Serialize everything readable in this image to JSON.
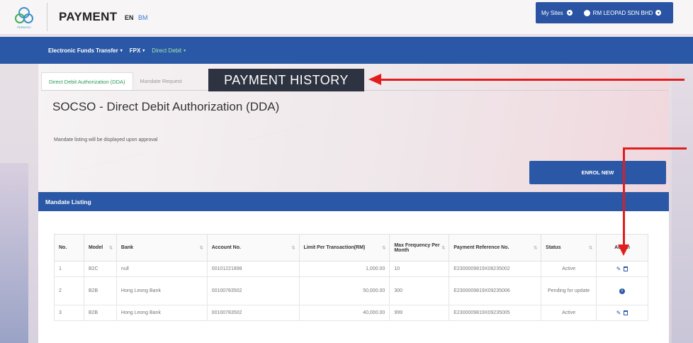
{
  "header": {
    "title": "PAYMENT",
    "lang_en": "EN",
    "lang_bm": "BM",
    "my_sites": "My Sites",
    "company": "RM LEOPAD SDN BHD",
    "logo_text": "PERKESO"
  },
  "nav": {
    "items": [
      {
        "label": "Electronic Funds Transfer",
        "active": false
      },
      {
        "label": "FPX",
        "active": false
      },
      {
        "label": "Direct Debit",
        "active": true
      }
    ]
  },
  "tabs": [
    {
      "label": "Direct Debit Authorization (DDA)",
      "active": true
    },
    {
      "label": "Mandate Request",
      "active": false
    }
  ],
  "callout": "PAYMENT HISTORY",
  "page": {
    "heading": "SOCSO - Direct Debit Authorization (DDA)",
    "note": "Mandate listing will be displayed upon approval",
    "enrol_label": "ENROL NEW",
    "panel_title": "Mandate Listing"
  },
  "table": {
    "headers": [
      "No.",
      "Model",
      "Bank",
      "Account No.",
      "Limit Per Transaction(RM)",
      "Max Frequency Per Month",
      "Payment Reference No.",
      "Status",
      "Action"
    ],
    "rows": [
      {
        "no": "1",
        "model": "B2C",
        "bank": "null",
        "account": "00101221898",
        "limit": "1,000.00",
        "freq": "10",
        "ref": "E2300009819X08235002",
        "status": "Active",
        "action": "edit-delete"
      },
      {
        "no": "2",
        "model": "B2B",
        "bank": "Hong Leong Bank",
        "account": "00100783502",
        "limit": "50,000.00",
        "freq": "300",
        "ref": "E2300009819X09235006",
        "status": "Pending for update",
        "action": "info"
      },
      {
        "no": "3",
        "model": "B2B",
        "bank": "Hong Leong Bank",
        "account": "00100783502",
        "limit": "40,000.00",
        "freq": "999",
        "ref": "E2300009819X09235005",
        "status": "Active",
        "action": "edit-delete"
      }
    ]
  },
  "colors": {
    "primary": "#2b58a6",
    "accent_green": "#2b9a55",
    "annotation_red": "#e11d1d"
  }
}
